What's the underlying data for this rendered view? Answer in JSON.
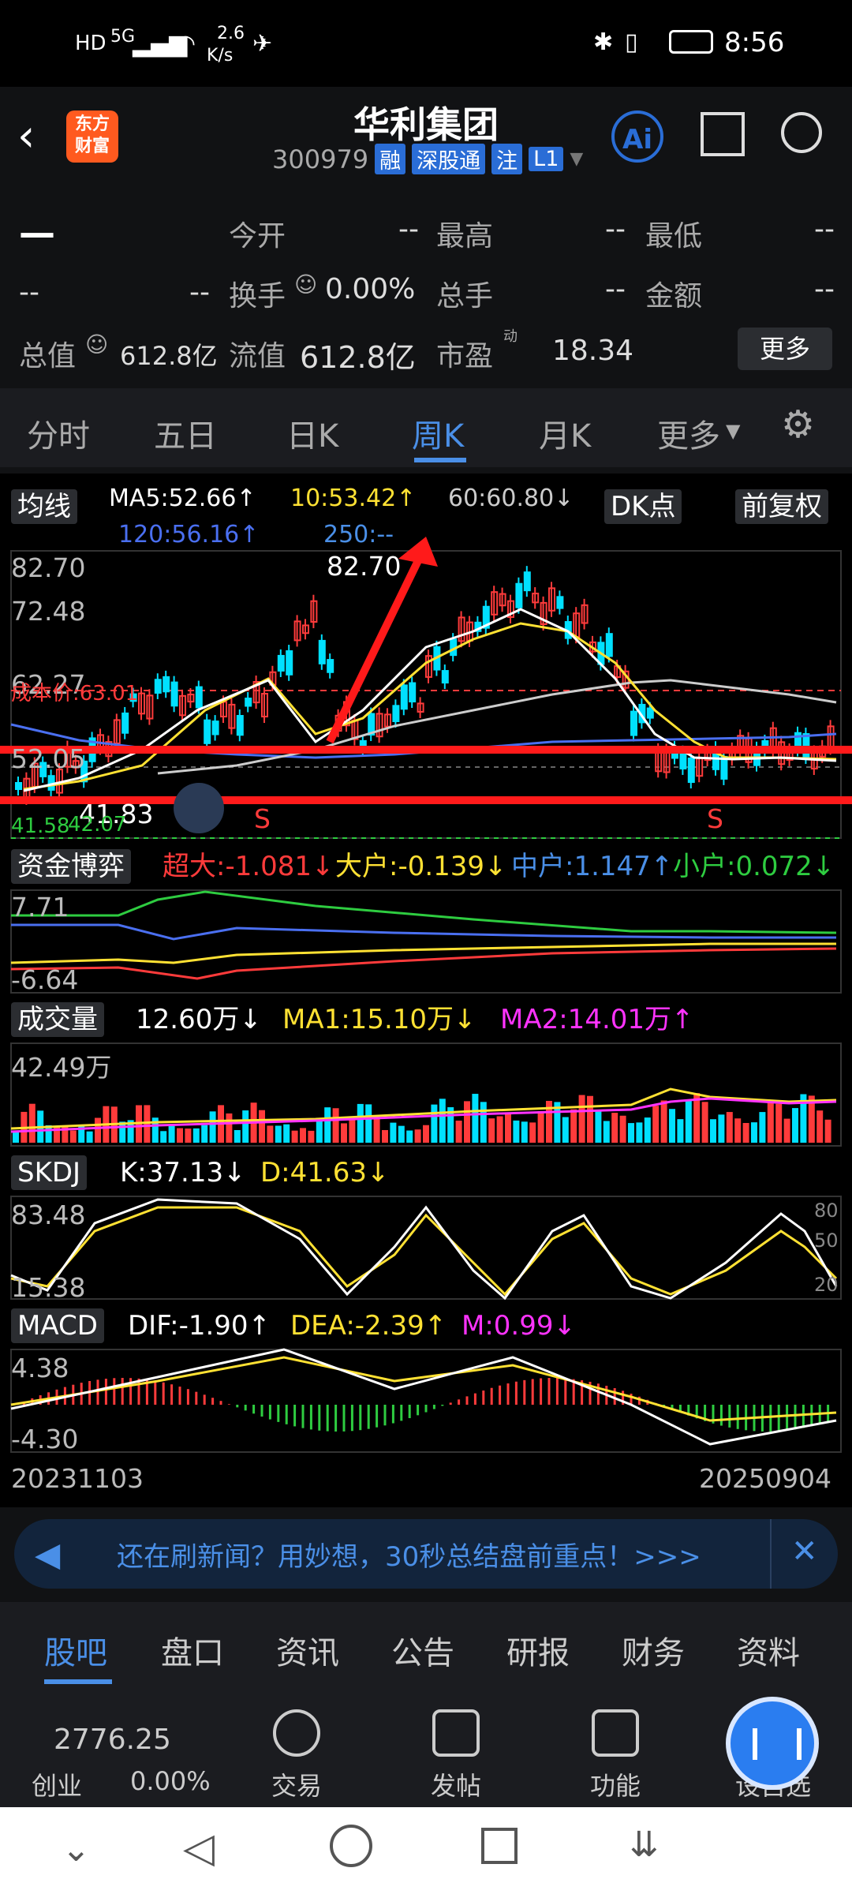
{
  "status": {
    "network": "5G",
    "speed_top": "2.6",
    "speed_bottom": "K/s",
    "time": "8:56"
  },
  "header": {
    "app_logo_line1": "东方",
    "app_logo_line2": "财富",
    "title": "华利集团",
    "code": "300979",
    "tags": [
      "融",
      "深股通",
      "注",
      "L1"
    ],
    "ai_label": "Ai"
  },
  "stats": {
    "price": "—",
    "change_a": "--",
    "change_b": "--",
    "open_label": "今开",
    "open_val": "--",
    "high_label": "最高",
    "high_val": "--",
    "low_label": "最低",
    "low_val": "--",
    "turnover_label": "换手",
    "turnover_val": "0.00%",
    "volume_label": "总手",
    "volume_val": "--",
    "amount_label": "金额",
    "amount_val": "--",
    "mktcap_label": "总值",
    "mktcap_val": "612.8亿",
    "float_label": "流值",
    "float_val": "612.8亿",
    "pe_label": "市盈",
    "pe_sup": "动",
    "pe_val": "18.34",
    "more_label": "更多"
  },
  "tabs": [
    "分时",
    "五日",
    "日K",
    "周K",
    "月K",
    "更多"
  ],
  "active_tab": "周K",
  "chart": {
    "ma_button": "均线",
    "ma5": "MA5:52.66↑",
    "ma10": "10:53.42↑",
    "ma60": "60:60.80↓",
    "ma120": "120:56.16↑",
    "ma250": "250:--",
    "dk_button": "DK点",
    "fq_button": "前复权",
    "y_top": "82.70",
    "y_2": "72.48",
    "y_3": "62.27",
    "y_4": "52.05",
    "y_5": "41.83",
    "y_6": "41.58",
    "peak_label": "82.70",
    "cost_label": "成本价:63.01",
    "low_label": "41.83",
    "low_label2": "42.07",
    "s1": "S",
    "s2": "S",
    "fund_button": "资金博弈",
    "fund_super": "超大:-1.081↓",
    "fund_large": "大户:-0.139↓",
    "fund_mid": "中户:1.147↑",
    "fund_small": "小户:0.072↓",
    "fund_y1": "7.71",
    "fund_y2": "-6.64",
    "vol_button": "成交量",
    "vol_val": "12.60万↓",
    "vol_ma1": "MA1:15.10万↓",
    "vol_ma2": "MA2:14.01万↑",
    "vol_y": "42.49万",
    "skdj_button": "SKDJ",
    "skdj_k": "K:37.13↓",
    "skdj_d": "D:41.63↓",
    "skdj_y1": "83.48",
    "skdj_y2": "15.38",
    "skdj_r1": "80",
    "skdj_r2": "50",
    "skdj_r3": "20",
    "macd_button": "MACD",
    "macd_dif": "DIF:-1.90↑",
    "macd_dea": "DEA:-2.39↑",
    "macd_m": "M:0.99↓",
    "macd_y1": "4.38",
    "macd_y2": "-4.30",
    "date_start": "20231103",
    "date_end": "20250904"
  },
  "banner": {
    "text": "还在刷新闻？用妙想，30秒总结盘前重点！>>>"
  },
  "subtabs": [
    "股吧",
    "盘口",
    "资讯",
    "公告",
    "研报",
    "财务",
    "资料"
  ],
  "bottom": {
    "index_val": "2776.25",
    "index_name": "创业",
    "index_chg": "0.00%",
    "trade": "交易",
    "post": "发帖",
    "func": "功能",
    "watch": "设自选"
  },
  "colors": {
    "accent": "#4a8fe7",
    "up": "#ff3b3b",
    "down": "#00e0ff",
    "yellow": "#ffe133",
    "magenta": "#ff33ff",
    "green": "#2ecc40"
  }
}
